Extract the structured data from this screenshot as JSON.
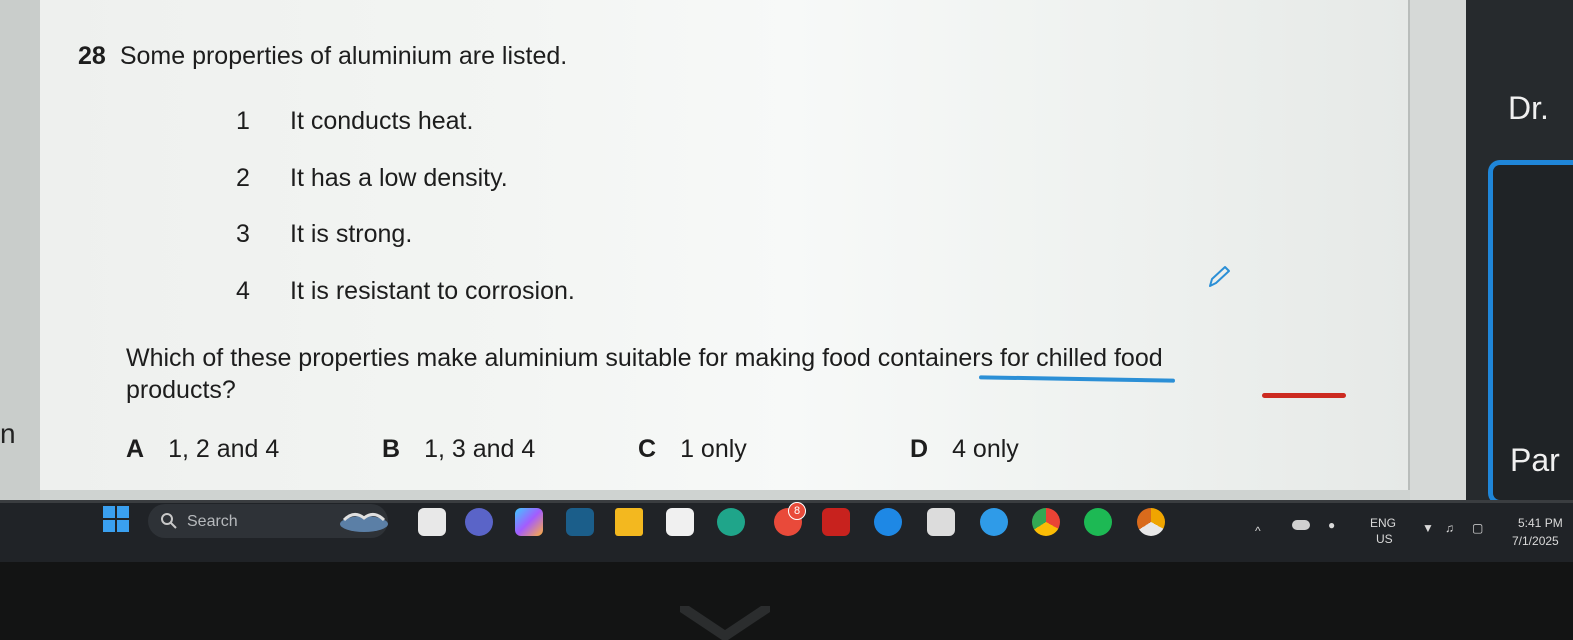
{
  "question": {
    "number": "28",
    "title": "Some properties of aluminium are listed.",
    "properties": [
      {
        "num": "1",
        "text": "It conducts heat."
      },
      {
        "num": "2",
        "text": "It has a low density."
      },
      {
        "num": "3",
        "text": "It is strong."
      },
      {
        "num": "4",
        "text": "It is resistant to corrosion."
      }
    ],
    "stem_line1": "Which of these properties make aluminium suitable for making food containers for chilled food",
    "stem_line2": "products?",
    "options": [
      {
        "letter": "A",
        "text": "1, 2 and 4"
      },
      {
        "letter": "B",
        "text": "1, 3 and 4"
      },
      {
        "letter": "C",
        "text": "1 only"
      },
      {
        "letter": "D",
        "text": "4 only"
      }
    ]
  },
  "side_panel": {
    "top_text": "Dr.",
    "bottom_text": "Par"
  },
  "left_edge_text": "n",
  "taskbar": {
    "search_label": "Search",
    "language": "ENG",
    "region": "US",
    "time": "5:41 PM",
    "date": "7/1/2025",
    "icons": [
      "windows-start-icon",
      "search-icon",
      "widgets-icon",
      "file-explorer-icon",
      "teams-icon",
      "copilot-icon",
      "photos-icon",
      "folder-icon",
      "store-icon",
      "edge-icon",
      "social-icon",
      "mcafee-icon",
      "browser-icon",
      "notepad-icon",
      "earth-icon",
      "chrome-icon",
      "spotify-icon",
      "chrome-canary-icon"
    ],
    "notification_badge": "8"
  },
  "colors": {
    "highlight_blue": "#2b8fd6",
    "highlight_red": "#cc2a20",
    "frame_blue": "#1f86d8"
  }
}
